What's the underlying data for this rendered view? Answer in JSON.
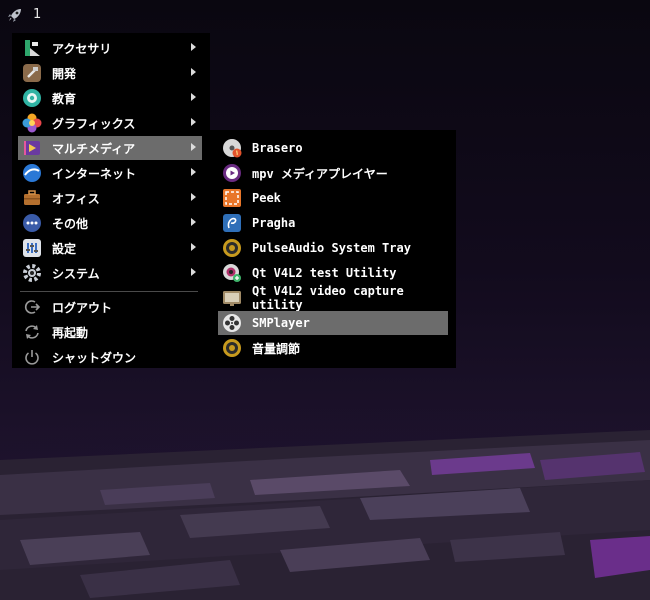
{
  "panel": {
    "desktop_number": "1",
    "launcher_icon": "rocket-icon"
  },
  "main_menu": {
    "items": [
      {
        "label": "アクセサリ",
        "icon": "accessories-icon"
      },
      {
        "label": "開発",
        "icon": "development-icon"
      },
      {
        "label": "教育",
        "icon": "education-icon"
      },
      {
        "label": "グラフィックス",
        "icon": "graphics-icon"
      },
      {
        "label": "マルチメディア",
        "icon": "multimedia-icon"
      },
      {
        "label": "インターネット",
        "icon": "internet-icon"
      },
      {
        "label": "オフィス",
        "icon": "office-icon"
      },
      {
        "label": "その他",
        "icon": "other-icon"
      },
      {
        "label": "設定",
        "icon": "settings-icon"
      },
      {
        "label": "システム",
        "icon": "system-icon"
      }
    ],
    "session": [
      {
        "label": "ログアウト",
        "icon": "logout-icon"
      },
      {
        "label": "再起動",
        "icon": "reboot-icon"
      },
      {
        "label": "シャットダウン",
        "icon": "shutdown-icon"
      }
    ],
    "highlighted": "マルチメディア"
  },
  "submenu": {
    "items": [
      {
        "label": "Brasero",
        "icon": "brasero-disc-icon"
      },
      {
        "label": "mpv メディアプレイヤー",
        "icon": "mpv-icon"
      },
      {
        "label": "Peek",
        "icon": "peek-icon"
      },
      {
        "label": "Pragha",
        "icon": "pragha-icon"
      },
      {
        "label": "PulseAudio System Tray",
        "icon": "pulseaudio-icon"
      },
      {
        "label": "Qt V4L2 test Utility",
        "icon": "qv4l2-icon"
      },
      {
        "label": "Qt V4L2 video capture utility",
        "icon": "video-capture-icon"
      },
      {
        "label": "SMPlayer",
        "icon": "smplayer-icon"
      },
      {
        "label": "音量調節",
        "icon": "volume-control-icon"
      }
    ],
    "highlighted": "SMPlayer"
  },
  "colors": {
    "menu_bg": "#000000",
    "highlight": "#6c6c6c",
    "text": "#ffffff"
  }
}
